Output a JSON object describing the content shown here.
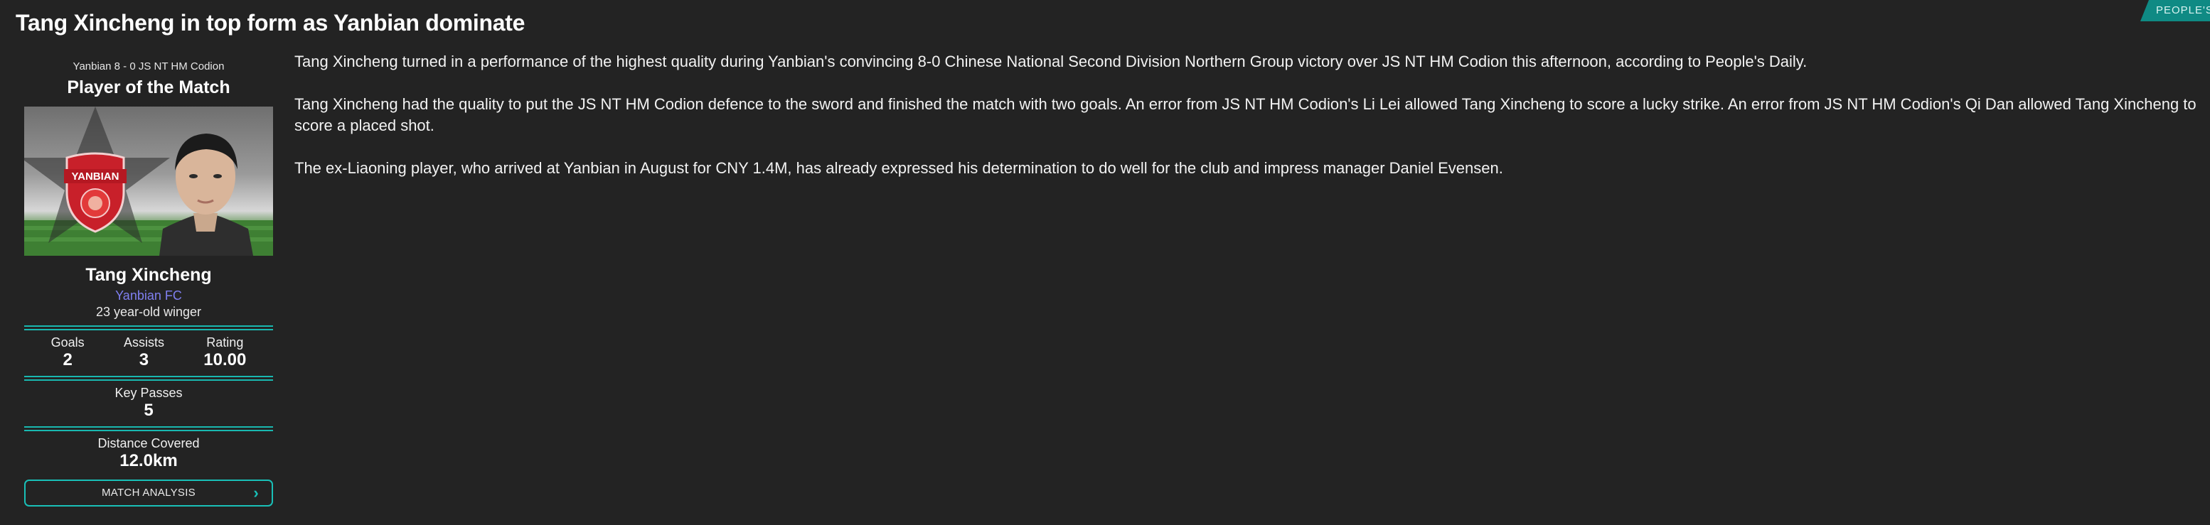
{
  "headline": "Tang Xincheng in top form as Yanbian dominate",
  "source_tag": "PEOPLE'S DAILY",
  "sidebar": {
    "match_line": "Yanbian 8 - 0 JS NT HM Codion",
    "award_title": "Player of the Match",
    "photo_badge_text": "YANBIAN",
    "player_name": "Tang Xincheng",
    "club": "Yanbian FC",
    "description": "23 year-old winger",
    "stats_row1": [
      {
        "label": "Goals",
        "value": "2"
      },
      {
        "label": "Assists",
        "value": "3"
      },
      {
        "label": "Rating",
        "value": "10.00"
      }
    ],
    "key_passes": {
      "label": "Key Passes",
      "value": "5"
    },
    "distance": {
      "label": "Distance Covered",
      "value": "12.0km"
    },
    "button_label": "MATCH ANALYSIS",
    "button_icon": "chevron-right-icon"
  },
  "article": {
    "paragraphs": [
      "Tang Xincheng turned in a performance of the highest quality during Yanbian's convincing 8-0 Chinese National Second Division Northern Group victory over JS NT HM Codion this afternoon, according to People's Daily.",
      "Tang Xincheng had the quality to put the JS NT HM Codion defence to the sword and finished the match with two goals. An error from JS NT HM Codion's Li Lei allowed Tang Xincheng to score a lucky strike. An error from JS NT HM Codion's Qi Dan allowed Tang Xincheng to score a placed shot.",
      "The ex-Liaoning player, who arrived at Yanbian in August for CNY 1.4M, has already expressed his determination to do well for the club and impress manager Daniel Evensen."
    ]
  },
  "colors": {
    "background": "#232323",
    "accent_teal": "#19b8b0",
    "club_link": "#7f7ff0",
    "source_tag_bg": "#0f8a84"
  }
}
